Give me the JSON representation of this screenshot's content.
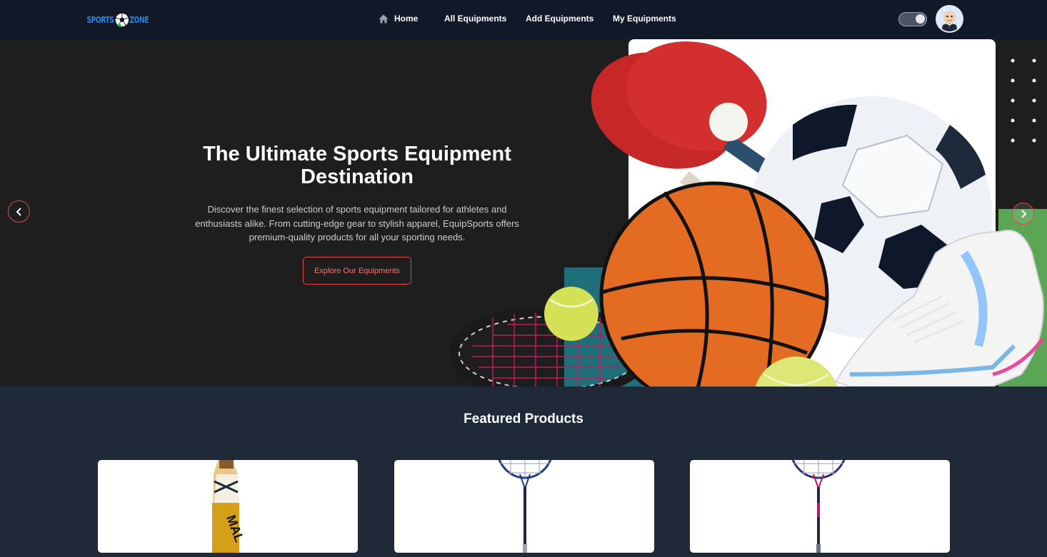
{
  "brand": {
    "logo_left": "SPORTS",
    "logo_right": "ZONE",
    "logo_icon": "soccer-ball-icon"
  },
  "nav": {
    "items": [
      {
        "label": "Home",
        "icon": "home-icon"
      },
      {
        "label": "All Equipments"
      },
      {
        "label": "Add Equipments"
      },
      {
        "label": "My Equipments"
      }
    ]
  },
  "theme_toggle": {
    "state": "dark"
  },
  "hero": {
    "title": "The Ultimate Sports Equipment Destination",
    "description": "Discover the finest selection of sports equipment tailored for athletes and enthusiasts alike. From cutting-edge gear to stylish apparel, EquipSports offers premium-quality products for all your sporting needs.",
    "cta_label": "Explore Our Equipments",
    "prev_icon": "chevron-left-icon",
    "next_icon": "chevron-right-icon"
  },
  "featured": {
    "title": "Featured Products",
    "cards": [
      {
        "image": "cricket-bat",
        "bat_brand": "MAL"
      },
      {
        "image": "badminton-racket"
      },
      {
        "image": "badminton-racket"
      }
    ]
  },
  "colors": {
    "nav_bg": "#111827",
    "hero_bg": "#1e1e1e",
    "page_bg": "#1f2937",
    "accent": "#ef4444"
  }
}
